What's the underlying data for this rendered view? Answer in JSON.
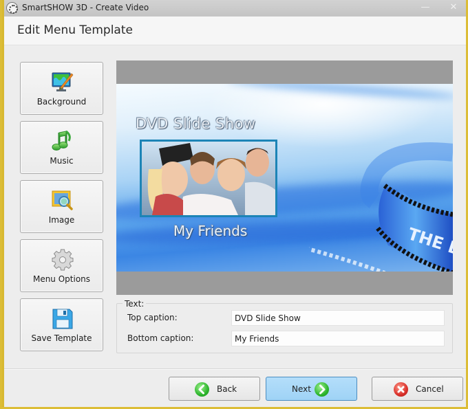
{
  "window": {
    "title": "SmartSHOW 3D - Create Video",
    "controls": {
      "minimize": "—",
      "close": "✕"
    }
  },
  "header": {
    "title": "Edit Menu Template"
  },
  "sidebar": {
    "items": [
      {
        "label": "Background",
        "icon": "monitor-paint-icon"
      },
      {
        "label": "Music",
        "icon": "music-note-icon"
      },
      {
        "label": "Image",
        "icon": "image-search-icon"
      },
      {
        "label": "Menu Options",
        "icon": "gear-icon"
      },
      {
        "label": "Save Template",
        "icon": "floppy-disk-icon"
      }
    ]
  },
  "preview": {
    "top_caption": "DVD Slide Show",
    "bottom_caption": "My Friends",
    "film_text": "THE END"
  },
  "text_group": {
    "title": "Text:",
    "fields": [
      {
        "label": "Top caption:",
        "value": "DVD Slide Show"
      },
      {
        "label": "Bottom caption:",
        "value": "My Friends"
      }
    ]
  },
  "footer": {
    "back_label": "Back",
    "next_label": "Next",
    "cancel_label": "Cancel"
  },
  "colors": {
    "window_frame": "#dcbd36",
    "primary_button": "#a8d8f8",
    "back_next_icon": "#2db52d",
    "cancel_icon": "#d9302a",
    "photo_border": "#1c84b6"
  }
}
